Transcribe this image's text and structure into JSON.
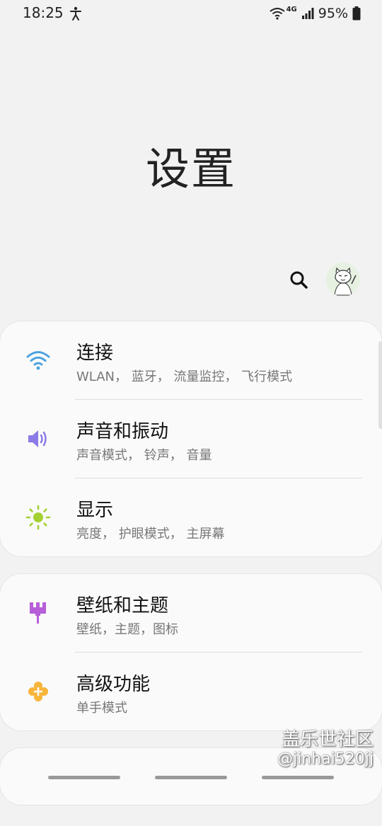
{
  "status_bar": {
    "time": "18:25",
    "network": "4G",
    "battery": "95%"
  },
  "page": {
    "title": "设置"
  },
  "icons": {
    "search": "search-icon",
    "avatar": "avatar",
    "accessibility": "accessibility-icon",
    "wifi": "wifi-icon",
    "volume": "volume-icon",
    "brightness": "brightness-icon",
    "paintbrush": "paintbrush-icon",
    "advanced": "advanced-features-icon"
  },
  "colors": {
    "connections": "#4aa3df",
    "sounds": "#8b7be7",
    "display": "#a3d132",
    "wallpapers": "#b65fd8",
    "advanced": "#f7b53a"
  },
  "settings_groups": [
    {
      "items": [
        {
          "title": "连接",
          "subtitle": "WLAN， 蓝牙， 流量监控， 飞行模式"
        },
        {
          "title": "声音和振动",
          "subtitle": "声音模式， 铃声， 音量"
        },
        {
          "title": "显示",
          "subtitle": "亮度， 护眼模式， 主屏幕"
        }
      ]
    },
    {
      "items": [
        {
          "title": "壁纸和主题",
          "subtitle": "壁纸，主题，图标"
        },
        {
          "title": "高级功能",
          "subtitle": "单手模式"
        }
      ]
    },
    {
      "items": [
        {
          "title": "",
          "subtitle": ""
        }
      ]
    }
  ],
  "watermark": {
    "line1": "盖乐世社区",
    "line2": "@jinhai520jj"
  }
}
